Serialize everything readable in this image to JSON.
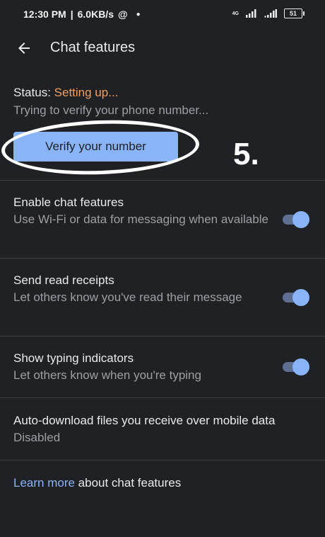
{
  "status_bar": {
    "time": "12:30 PM",
    "speed": "6.0KB/s",
    "network": "4G",
    "battery": "51"
  },
  "header": {
    "title": "Chat features"
  },
  "status": {
    "label": "Status:",
    "value": "Setting up...",
    "message": "Trying to verify your phone number..."
  },
  "verify_button": {
    "label": "Verify your number"
  },
  "annotation": {
    "step": "5."
  },
  "settings": [
    {
      "title": "Enable chat features",
      "subtitle": "Use Wi-Fi or data for messaging when available",
      "enabled": true
    },
    {
      "title": "Send read receipts",
      "subtitle": "Let others know you've read their message",
      "enabled": true
    },
    {
      "title": "Show typing indicators",
      "subtitle": "Let others know when you're typing",
      "enabled": true
    }
  ],
  "auto_download": {
    "title": "Auto-download files you receive over mobile data",
    "value": "Disabled"
  },
  "learn_more": {
    "link": "Learn more",
    "rest": " about chat features"
  },
  "colors": {
    "background": "#202124",
    "accent": "#8ab4f8",
    "status_orange": "#f29e5c"
  }
}
